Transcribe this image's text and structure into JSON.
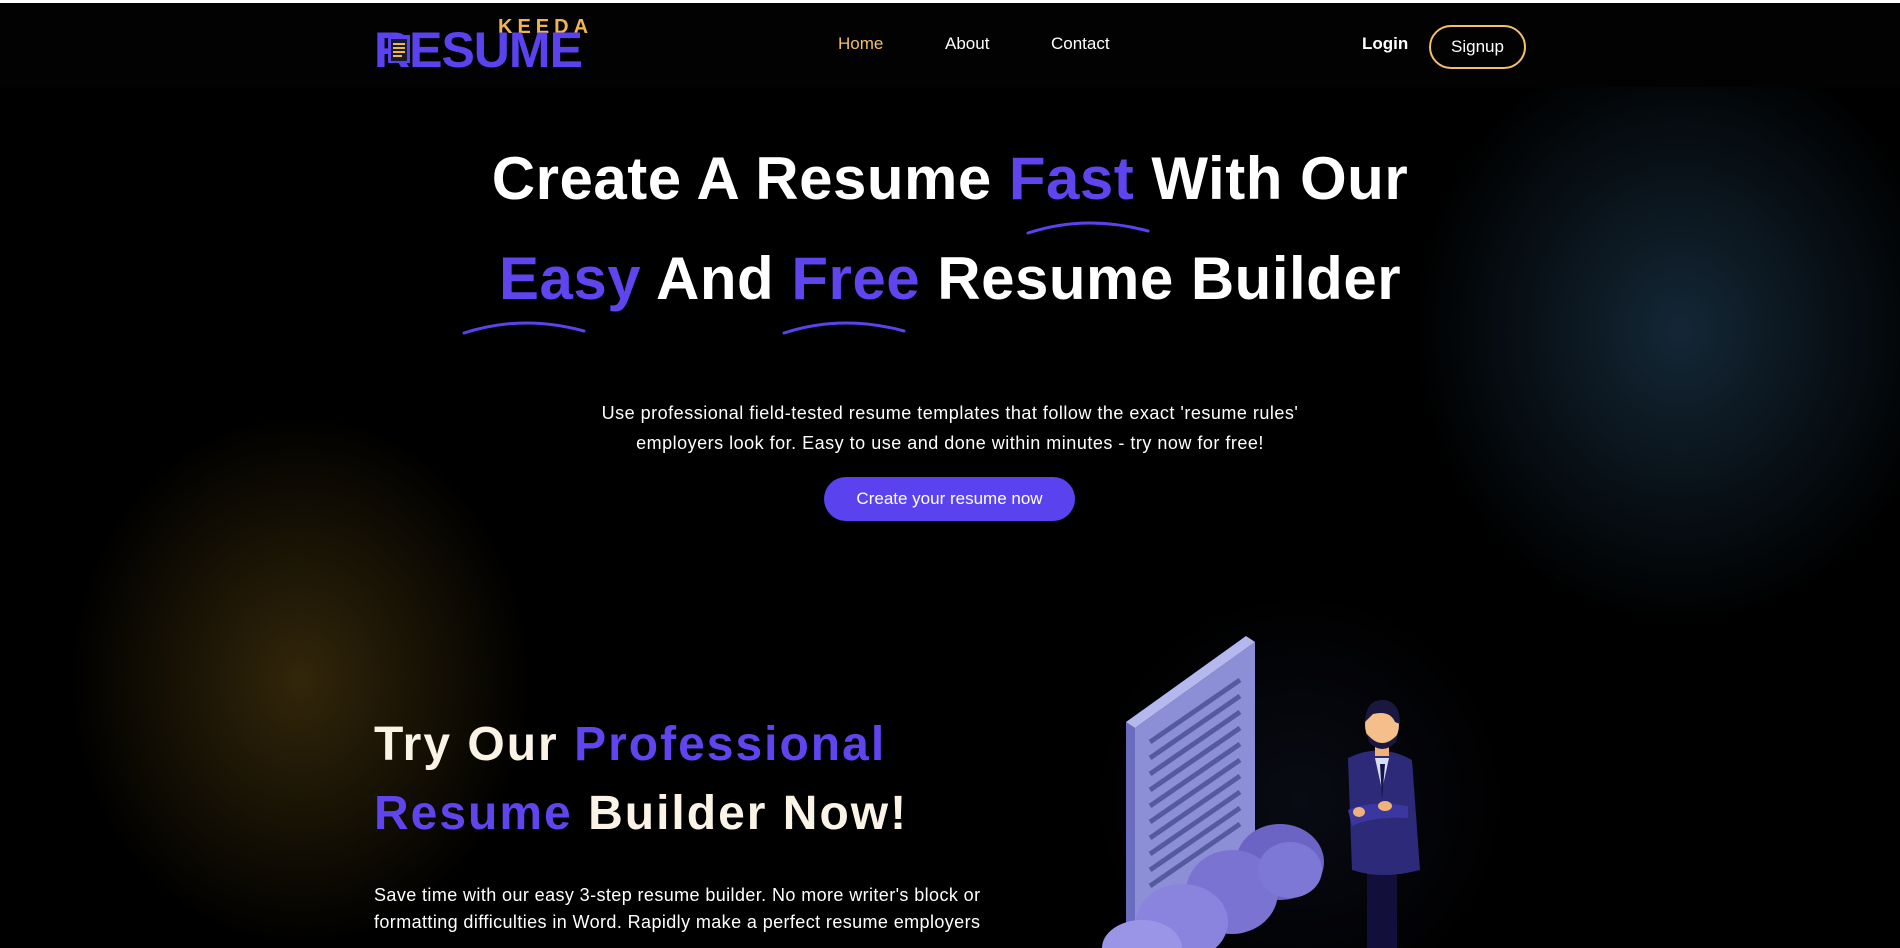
{
  "brand": {
    "top_word": "KEEDA",
    "main_word": "RESUME",
    "colors": {
      "primary": "#5a43ee",
      "secondary": "#f0b552"
    }
  },
  "nav": {
    "links": [
      {
        "label": "Home",
        "active": true
      },
      {
        "label": "About",
        "active": false
      },
      {
        "label": "Contact",
        "active": false
      }
    ],
    "login_label": "Login",
    "signup_label": "Signup"
  },
  "hero": {
    "line1": {
      "part1": "Create A Resume ",
      "accent": "Fast",
      "part2": " With Our"
    },
    "line2": {
      "accent1": "Easy",
      "part1": " And ",
      "accent2": "Free",
      "part2": " Resume Builder"
    },
    "subtitle_line1": "Use professional field-tested resume templates that follow the exact 'resume rules'",
    "subtitle_line2": "employers look for. Easy to use and done within minutes - try now for free!",
    "cta_label": "Create your resume now"
  },
  "section2": {
    "title_line1_plain": "Try Our ",
    "title_line1_accent": "Professional",
    "title_line2_accent": "Resume",
    "title_line2_plain": " Builder Now!",
    "text_line1": "Save time with our easy 3-step resume builder. No more writer's block or",
    "text_line2": "formatting difficulties in Word. Rapidly make a perfect resume employers"
  },
  "icons": {
    "logo_document": "document-icon",
    "illustration": "resume-man-cloud-illustration"
  }
}
